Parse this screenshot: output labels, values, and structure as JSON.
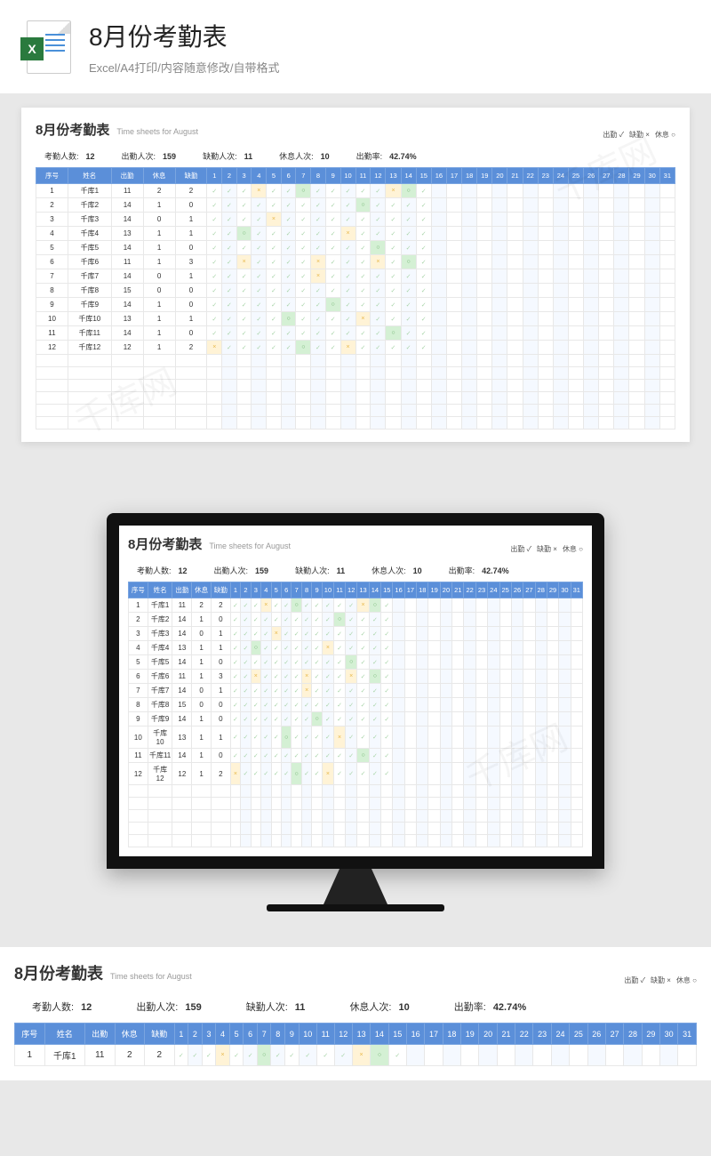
{
  "header": {
    "title": "8月份考勤表",
    "subtitle": "Excel/A4打印/内容随意修改/自带格式",
    "excel_x": "X"
  },
  "sheet": {
    "title": "8月份考勤表",
    "title_en": "Time sheets for August"
  },
  "legend": {
    "present": "出勤 ✓",
    "absent": "缺勤 ×",
    "rest": "休息 ○"
  },
  "stats": {
    "count_label": "考勤人数:",
    "count": "12",
    "present_label": "出勤人次:",
    "present": "159",
    "absent_label": "缺勤人次:",
    "absent": "11",
    "rest_label": "休息人次:",
    "rest": "10",
    "rate_label": "出勤率:",
    "rate": "42.74%"
  },
  "headers": {
    "seq": "序号",
    "name": "姓名",
    "present": "出勤",
    "rest": "休息",
    "absent": "缺勤"
  },
  "days": [
    "1",
    "2",
    "3",
    "4",
    "5",
    "6",
    "7",
    "8",
    "9",
    "10",
    "11",
    "12",
    "13",
    "14",
    "15",
    "16",
    "17",
    "18",
    "19",
    "20",
    "21",
    "22",
    "23",
    "24",
    "25",
    "26",
    "27",
    "28",
    "29",
    "30",
    "31"
  ],
  "rows": [
    {
      "seq": "1",
      "name": "千库1",
      "present": "11",
      "rest": "2",
      "absent": "2"
    },
    {
      "seq": "2",
      "name": "千库2",
      "present": "14",
      "rest": "1",
      "absent": "0"
    },
    {
      "seq": "3",
      "name": "千库3",
      "present": "14",
      "rest": "0",
      "absent": "1"
    },
    {
      "seq": "4",
      "name": "千库4",
      "present": "13",
      "rest": "1",
      "absent": "1"
    },
    {
      "seq": "5",
      "name": "千库5",
      "present": "14",
      "rest": "1",
      "absent": "0"
    },
    {
      "seq": "6",
      "name": "千库6",
      "present": "11",
      "rest": "1",
      "absent": "3"
    },
    {
      "seq": "7",
      "name": "千库7",
      "present": "14",
      "rest": "0",
      "absent": "1"
    },
    {
      "seq": "8",
      "name": "千库8",
      "present": "15",
      "rest": "0",
      "absent": "0"
    },
    {
      "seq": "9",
      "name": "千库9",
      "present": "14",
      "rest": "1",
      "absent": "0"
    },
    {
      "seq": "10",
      "name": "千库10",
      "present": "13",
      "rest": "1",
      "absent": "1"
    },
    {
      "seq": "11",
      "name": "千库11",
      "present": "14",
      "rest": "1",
      "absent": "0"
    },
    {
      "seq": "12",
      "name": "千库12",
      "present": "12",
      "rest": "1",
      "absent": "2"
    }
  ],
  "marks": {
    "1": {
      "1": "c",
      "2": "c",
      "3": "c",
      "4": "x",
      "5": "c",
      "6": "c",
      "7": "r",
      "8": "c",
      "9": "c",
      "10": "c",
      "11": "c",
      "12": "c",
      "13": "x",
      "14": "r",
      "15": "c"
    },
    "2": {
      "1": "c",
      "2": "c",
      "3": "c",
      "4": "c",
      "5": "c",
      "6": "c",
      "7": "c",
      "8": "c",
      "9": "c",
      "10": "c",
      "11": "r",
      "12": "c",
      "13": "c",
      "14": "c",
      "15": "c"
    },
    "3": {
      "1": "c",
      "2": "c",
      "3": "c",
      "4": "c",
      "5": "x",
      "6": "c",
      "7": "c",
      "8": "c",
      "9": "c",
      "10": "c",
      "11": "c",
      "12": "c",
      "13": "c",
      "14": "c",
      "15": "c"
    },
    "4": {
      "1": "c",
      "2": "c",
      "3": "r",
      "4": "c",
      "5": "c",
      "6": "c",
      "7": "c",
      "8": "c",
      "9": "c",
      "10": "x",
      "11": "c",
      "12": "c",
      "13": "c",
      "14": "c",
      "15": "c"
    },
    "5": {
      "1": "c",
      "2": "c",
      "3": "c",
      "4": "c",
      "5": "c",
      "6": "c",
      "7": "c",
      "8": "c",
      "9": "c",
      "10": "c",
      "11": "c",
      "12": "r",
      "13": "c",
      "14": "c",
      "15": "c"
    },
    "6": {
      "1": "c",
      "2": "c",
      "3": "x",
      "4": "c",
      "5": "c",
      "6": "c",
      "7": "c",
      "8": "x",
      "9": "c",
      "10": "c",
      "11": "c",
      "12": "x",
      "13": "c",
      "14": "r",
      "15": "c"
    },
    "7": {
      "1": "c",
      "2": "c",
      "3": "c",
      "4": "c",
      "5": "c",
      "6": "c",
      "7": "c",
      "8": "x",
      "9": "c",
      "10": "c",
      "11": "c",
      "12": "c",
      "13": "c",
      "14": "c",
      "15": "c"
    },
    "8": {
      "1": "c",
      "2": "c",
      "3": "c",
      "4": "c",
      "5": "c",
      "6": "c",
      "7": "c",
      "8": "c",
      "9": "c",
      "10": "c",
      "11": "c",
      "12": "c",
      "13": "c",
      "14": "c",
      "15": "c"
    },
    "9": {
      "1": "c",
      "2": "c",
      "3": "c",
      "4": "c",
      "5": "c",
      "6": "c",
      "7": "c",
      "8": "c",
      "9": "r",
      "10": "c",
      "11": "c",
      "12": "c",
      "13": "c",
      "14": "c",
      "15": "c"
    },
    "10": {
      "1": "c",
      "2": "c",
      "3": "c",
      "4": "c",
      "5": "c",
      "6": "r",
      "7": "c",
      "8": "c",
      "9": "c",
      "10": "c",
      "11": "x",
      "12": "c",
      "13": "c",
      "14": "c",
      "15": "c"
    },
    "11": {
      "1": "c",
      "2": "c",
      "3": "c",
      "4": "c",
      "5": "c",
      "6": "c",
      "7": "c",
      "8": "c",
      "9": "c",
      "10": "c",
      "11": "c",
      "12": "c",
      "13": "r",
      "14": "c",
      "15": "c"
    },
    "12": {
      "1": "x",
      "2": "c",
      "3": "c",
      "4": "c",
      "5": "c",
      "6": "c",
      "7": "r",
      "8": "c",
      "9": "c",
      "10": "x",
      "11": "c",
      "12": "c",
      "13": "c",
      "14": "c",
      "15": "c"
    }
  },
  "watermark": "千库网"
}
